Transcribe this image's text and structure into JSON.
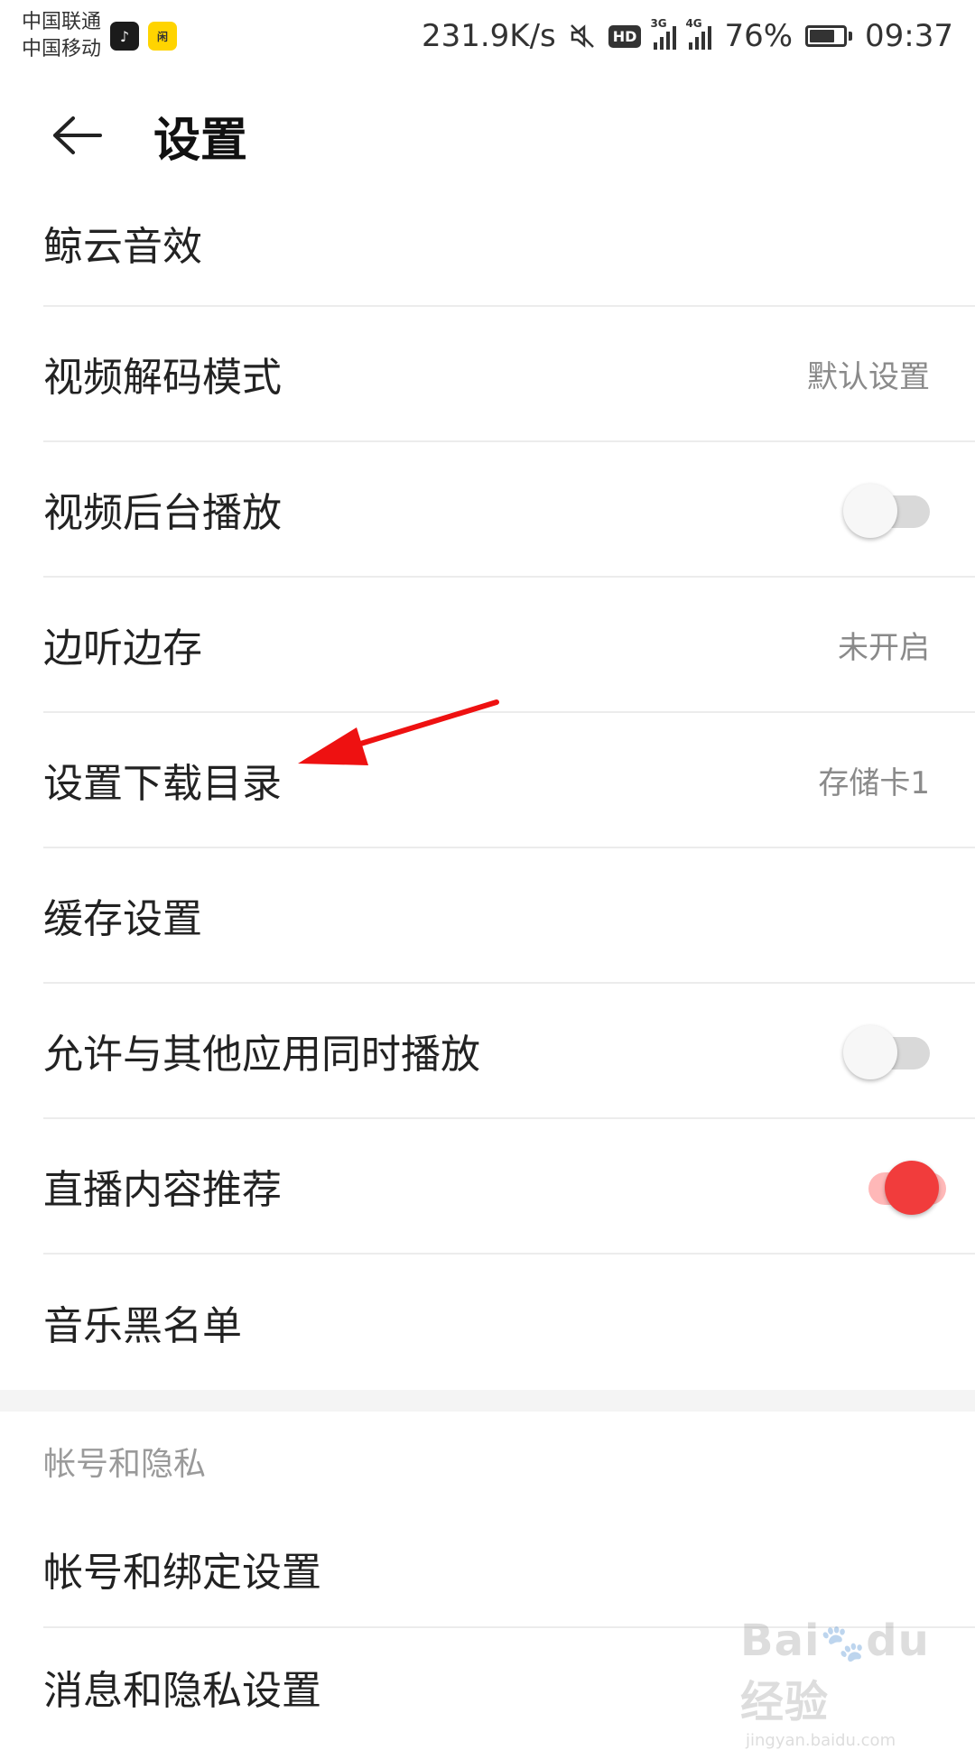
{
  "statusbar": {
    "carrier1": "中国联通",
    "carrier2": "中国移动",
    "network_speed": "231.9K/s",
    "hd_badge": "HD",
    "sig3g_label": "3G",
    "sig4g_label": "4G",
    "battery_percent": "76%",
    "battery_level": 0.76,
    "time": "09:37",
    "icons": [
      "tiktok-app-icon",
      "xianyu-app-icon",
      "mute-icon",
      "signal-icon",
      "battery-icon"
    ]
  },
  "header": {
    "title": "设置"
  },
  "settings": {
    "items": [
      {
        "label": "鲸云音效"
      },
      {
        "label": "视频解码模式",
        "value": "默认设置"
      },
      {
        "label": "视频后台播放",
        "toggle": false
      },
      {
        "label": "边听边存",
        "value": "未开启"
      },
      {
        "label": "设置下载目录",
        "value": "存储卡1"
      },
      {
        "label": "缓存设置"
      },
      {
        "label": "允许与其他应用同时播放",
        "toggle": false
      },
      {
        "label": "直播内容推荐",
        "toggle": true
      },
      {
        "label": "音乐黑名单"
      }
    ]
  },
  "account_section": {
    "header": "帐号和隐私",
    "items": [
      {
        "label": "帐号和绑定设置"
      },
      {
        "label": "消息和隐私设置"
      }
    ]
  },
  "colors": {
    "accent": "#f13c3c",
    "annotation_arrow": "#ee1111"
  }
}
